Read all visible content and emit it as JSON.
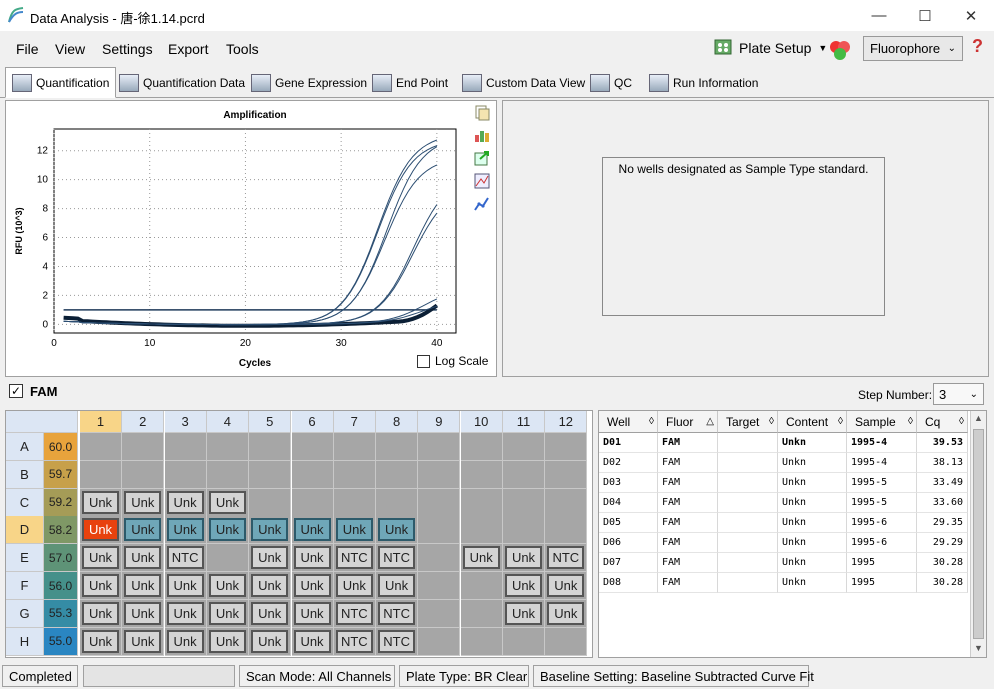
{
  "window": {
    "title": "Data Analysis - 唐-徐1.14.pcrd"
  },
  "menu": [
    "File",
    "View",
    "Settings",
    "Export",
    "Tools"
  ],
  "toolbar": {
    "plate_setup": "Plate Setup",
    "fluorophore": "Fluorophore"
  },
  "tabs": [
    "Quantification",
    "Quantification Data",
    "Gene Expression",
    "End Point",
    "Custom Data View",
    "QC",
    "Run Information"
  ],
  "chart": {
    "log_scale_label": "Log Scale"
  },
  "chart_data": {
    "type": "line",
    "title": "Amplification",
    "xlabel": "Cycles",
    "ylabel": "RFU (10^3)",
    "xlim": [
      0,
      42
    ],
    "ylim": [
      -0.6,
      13.5
    ],
    "xticks": [
      0,
      10,
      20,
      30,
      40
    ],
    "yticks": [
      0,
      2,
      4,
      6,
      8,
      10,
      12
    ],
    "threshold": 1.0,
    "grid": true,
    "series_profile": [
      {
        "cq": 29.3,
        "plateau": 13.0
      },
      {
        "cq": 29.35,
        "plateau": 12.6
      },
      {
        "cq": 30.28,
        "plateau": 12.8
      },
      {
        "cq": 30.28,
        "plateau": 11.4
      },
      {
        "cq": 33.49,
        "plateau": 10.2
      },
      {
        "cq": 33.6,
        "plateau": 9.4
      },
      {
        "cq": 38.13,
        "plateau": 2.4
      },
      {
        "cq": 39.53,
        "plateau": 1.6
      }
    ]
  },
  "standard_panel": {
    "message": "No wells designated as Sample Type standard."
  },
  "fam": {
    "label": "FAM",
    "step_label": "Step Number:",
    "step_value": "3"
  },
  "plate": {
    "columns": [
      "1",
      "2",
      "3",
      "4",
      "5",
      "6",
      "7",
      "8",
      "9",
      "10",
      "11",
      "12"
    ],
    "rows": [
      {
        "label": "A",
        "value": "60.0",
        "color": "#e8a33c",
        "wells": [
          "",
          "",
          "",
          "",
          "",
          "",
          "",
          "",
          "",
          "",
          "",
          ""
        ]
      },
      {
        "label": "B",
        "value": "59.7",
        "color": "#c7a04a",
        "wells": [
          "",
          "",
          "",
          "",
          "",
          "",
          "",
          "",
          "",
          "",
          "",
          ""
        ]
      },
      {
        "label": "C",
        "value": "59.2",
        "color": "#a59c57",
        "wells": [
          "Unk",
          "Unk",
          "Unk",
          "Unk",
          "",
          "",
          "",
          "",
          "",
          "",
          "",
          ""
        ]
      },
      {
        "label": "D",
        "value": "58.2",
        "color": "#7f9866",
        "wells": [
          "Unk",
          "Unk",
          "Unk",
          "Unk",
          "Unk",
          "Unk",
          "Unk",
          "Unk",
          "",
          "",
          "",
          ""
        ]
      },
      {
        "label": "E",
        "value": "57.0",
        "color": "#5e9377",
        "wells": [
          "Unk",
          "Unk",
          "NTC",
          "",
          "Unk",
          "Unk",
          "NTC",
          "NTC",
          "",
          "Unk",
          "Unk",
          "NTC"
        ]
      },
      {
        "label": "F",
        "value": "56.0",
        "color": "#45908a",
        "wells": [
          "Unk",
          "Unk",
          "Unk",
          "Unk",
          "Unk",
          "Unk",
          "Unk",
          "Unk",
          "",
          "",
          "Unk",
          "Unk"
        ]
      },
      {
        "label": "G",
        "value": "55.3",
        "color": "#358ca5",
        "wells": [
          "Unk",
          "Unk",
          "Unk",
          "Unk",
          "Unk",
          "Unk",
          "NTC",
          "NTC",
          "",
          "",
          "Unk",
          "Unk"
        ]
      },
      {
        "label": "H",
        "value": "55.0",
        "color": "#2a86c2",
        "wells": [
          "Unk",
          "Unk",
          "Unk",
          "Unk",
          "Unk",
          "Unk",
          "NTC",
          "NTC",
          "",
          "",
          "",
          ""
        ]
      }
    ]
  },
  "table": {
    "headers": [
      "Well",
      "Fluor",
      "Target",
      "Content",
      "Sample",
      "Cq"
    ],
    "rows": [
      [
        "D01",
        "FAM",
        "",
        "Unkn",
        "1995-4",
        "39.53"
      ],
      [
        "D02",
        "FAM",
        "",
        "Unkn",
        "1995-4",
        "38.13"
      ],
      [
        "D03",
        "FAM",
        "",
        "Unkn",
        "1995-5",
        "33.49"
      ],
      [
        "D04",
        "FAM",
        "",
        "Unkn",
        "1995-5",
        "33.60"
      ],
      [
        "D05",
        "FAM",
        "",
        "Unkn",
        "1995-6",
        "29.35"
      ],
      [
        "D06",
        "FAM",
        "",
        "Unkn",
        "1995-6",
        "29.29"
      ],
      [
        "D07",
        "FAM",
        "",
        "Unkn",
        "1995",
        "30.28"
      ],
      [
        "D08",
        "FAM",
        "",
        "Unkn",
        "1995",
        "30.28"
      ]
    ]
  },
  "status": {
    "state": "Completed",
    "scan_mode": "Scan Mode: All Channels",
    "plate_type": "Plate Type: BR Clear",
    "baseline": "Baseline Setting: Baseline Subtracted Curve Fit"
  }
}
